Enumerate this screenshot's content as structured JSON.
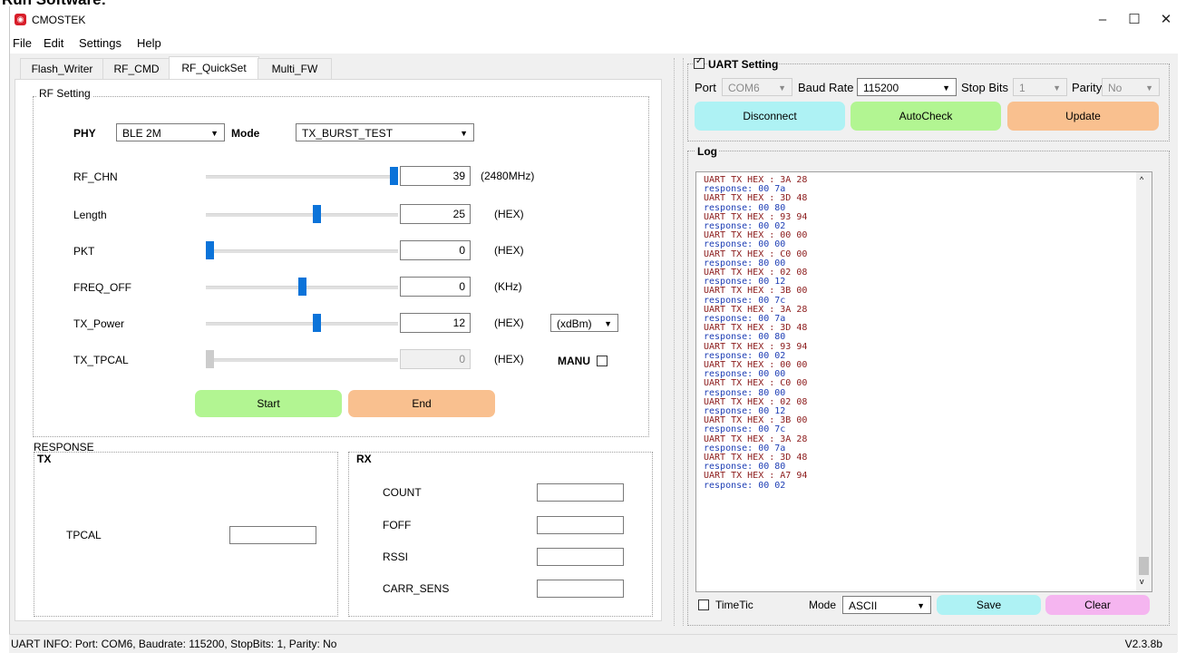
{
  "page_heading": "Run Software:",
  "window": {
    "title": "CMOSTEK",
    "minimize": "–",
    "maximize": "☐",
    "close": "✕"
  },
  "menu": [
    "File",
    "Edit",
    "Settings",
    "Help"
  ],
  "tabs": [
    "Flash_Writer",
    "RF_CMD",
    "RF_QuickSet",
    "Multi_FW"
  ],
  "rf_setting": {
    "group_title": "RF Setting",
    "phy_label": "PHY",
    "phy_value": "BLE 2M",
    "mode_label": "Mode",
    "mode_value": "TX_BURST_TEST",
    "rows": [
      {
        "label": "RF_CHN",
        "value": "39",
        "unit": "(2480MHz)",
        "level": 1.0,
        "enabled": true
      },
      {
        "label": "Length",
        "value": "25",
        "unit": "(HEX)",
        "level": 0.58,
        "enabled": true
      },
      {
        "label": "PKT",
        "value": "0",
        "unit": "(HEX)",
        "level": 0.0,
        "enabled": true
      },
      {
        "label": "FREQ_OFF",
        "value": "0",
        "unit": "(KHz)",
        "level": 0.5,
        "enabled": true
      },
      {
        "label": "TX_Power",
        "value": "12",
        "unit": "(HEX)",
        "level": 0.58,
        "enabled": true
      },
      {
        "label": "TX_TPCAL",
        "value": "0",
        "unit": "(HEX)",
        "level": 0.0,
        "enabled": false
      }
    ],
    "power_unit_select": "(xdBm)",
    "manu_label": "MANU",
    "start_button": "Start",
    "end_button": "End"
  },
  "response": {
    "group_title": "RESPONSE",
    "tx_title": "TX",
    "tpcal_label": "TPCAL",
    "rx_title": "RX",
    "rx_labels": [
      "COUNT",
      "FOFF",
      "RSSI",
      "CARR_SENS"
    ]
  },
  "uart": {
    "title": "UART Setting",
    "port_label": "Port",
    "port_value": "COM6",
    "baud_label": "Baud Rate",
    "baud_value": "115200",
    "stop_label": "Stop Bits",
    "stop_value": "1",
    "parity_label": "Parity",
    "parity_value": "No",
    "disconnect_button": "Disconnect",
    "autocheck_button": "AutoCheck",
    "update_button": "Update"
  },
  "log": {
    "title": "Log",
    "lines": [
      "UART TX HEX : 3A 28",
      "response: 00 7a",
      "UART TX HEX : 3D 48",
      "response: 00 80",
      "UART TX HEX : 93 94",
      "response: 00 02",
      "UART TX HEX : 00 00",
      "response: 00 00",
      "UART TX HEX : C0 00",
      "response: 80 00",
      "UART TX HEX : 02 08",
      "response: 00 12",
      "UART TX HEX : 3B 00",
      "response: 00 7c",
      "UART TX HEX : 3A 28",
      "response: 00 7a",
      "UART TX HEX : 3D 48",
      "response: 00 80",
      "UART TX HEX : 93 94",
      "response: 00 02",
      "UART TX HEX : 00 00",
      "response: 00 00",
      "UART TX HEX : C0 00",
      "response: 80 00",
      "UART TX HEX : 02 08",
      "response: 00 12",
      "UART TX HEX : 3B 00",
      "response: 00 7c",
      "UART TX HEX : 3A 28",
      "response: 00 7a",
      "UART TX HEX : 3D 48",
      "response: 00 80",
      "UART TX HEX : A7 94",
      "response: 00 02"
    ],
    "timetic_label": "TimeTic",
    "mode_label": "Mode",
    "mode_value": "ASCII",
    "save_button": "Save",
    "clear_button": "Clear"
  },
  "status": {
    "info": "UART INFO: Port: COM6, Baudrate: 115200, StopBits: 1, Parity: No",
    "version": "V2.3.8b"
  },
  "colors": {
    "green": "#b2f592",
    "orange": "#f9c08f",
    "cyan": "#aef2f4",
    "pink": "#f5b5f0",
    "slider": "#0b73d9"
  }
}
